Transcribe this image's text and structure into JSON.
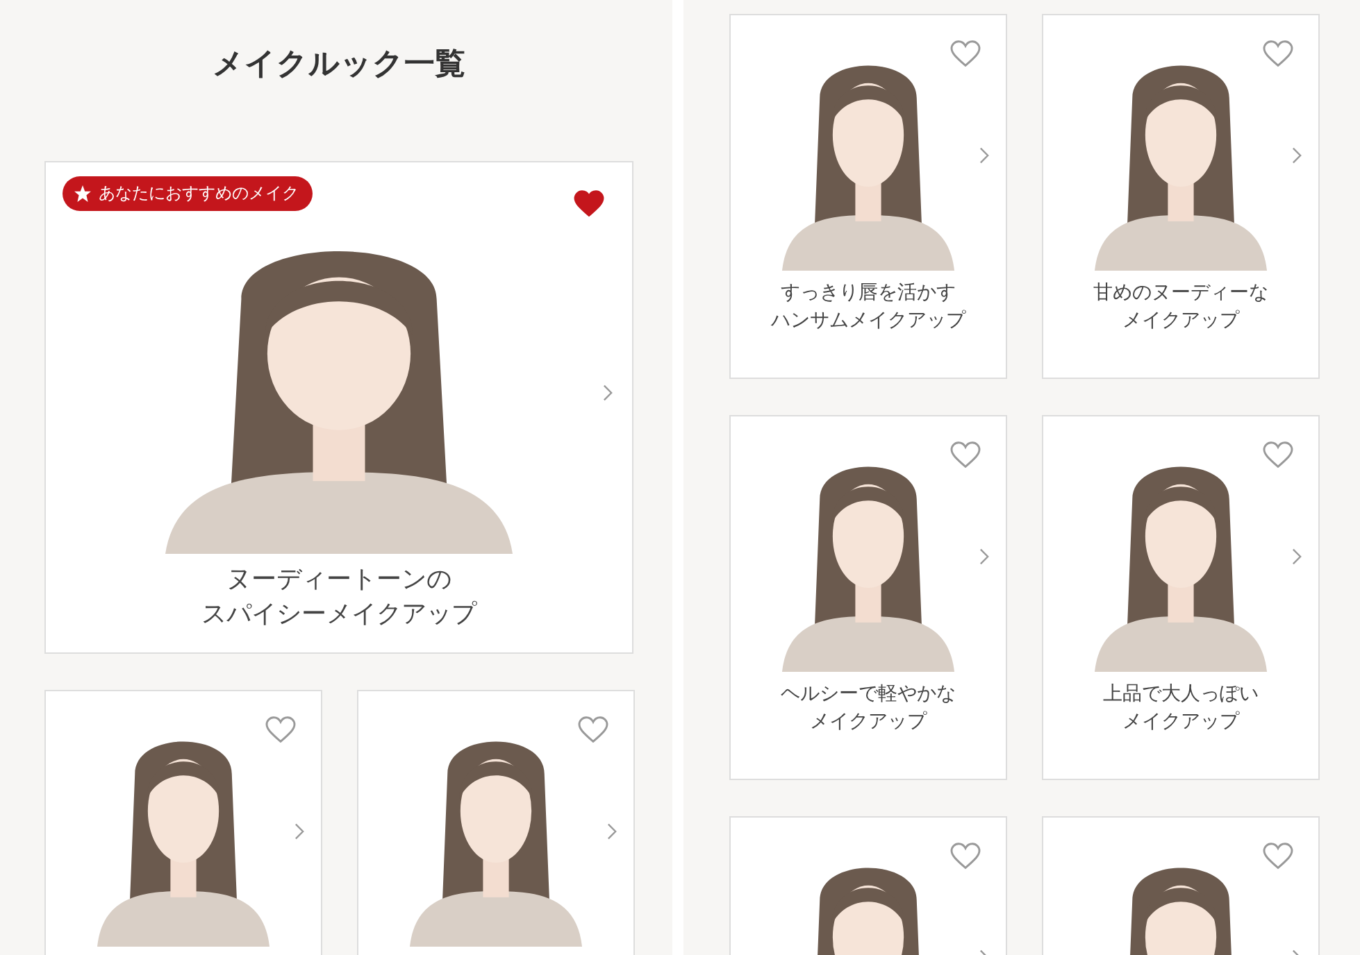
{
  "left_screen": {
    "title": "メイクルック一覧",
    "featured": {
      "badge": "あなたにおすすめのメイク",
      "favorite": true,
      "caption": [
        "ヌーディートーンの",
        "スパイシーメイクアップ"
      ]
    },
    "cards": [
      {
        "favorite": false
      },
      {
        "favorite": false
      }
    ]
  },
  "right_screen": {
    "cards": [
      {
        "favorite": false,
        "caption": [
          "すっきり唇を活かす",
          "ハンサムメイクアップ"
        ]
      },
      {
        "favorite": false,
        "caption": [
          "甘めのヌーディーな",
          "メイクアップ"
        ]
      },
      {
        "favorite": false,
        "caption": [
          "ヘルシーで軽やかな",
          "メイクアップ"
        ]
      },
      {
        "favorite": false,
        "caption": [
          "上品で大人っぽい",
          "メイクアップ"
        ]
      },
      {
        "favorite": false
      },
      {
        "favorite": false
      }
    ]
  }
}
